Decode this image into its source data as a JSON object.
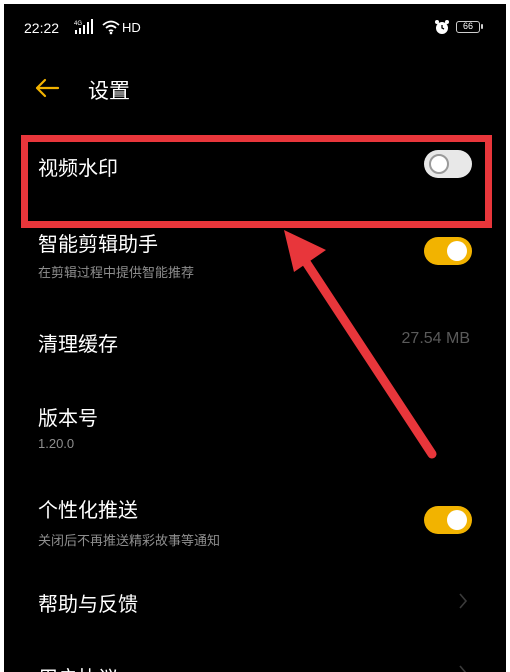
{
  "status_bar": {
    "time": "22:22",
    "network_label": "4G",
    "hd_label": "HD",
    "battery_level": "66"
  },
  "header": {
    "title": "设置"
  },
  "settings": {
    "video_watermark": {
      "title": "视频水印",
      "enabled": false
    },
    "smart_edit": {
      "title": "智能剪辑助手",
      "subtitle": "在剪辑过程中提供智能推荐",
      "enabled": true
    },
    "clear_cache": {
      "title": "清理缓存",
      "value": "27.54 MB"
    },
    "version": {
      "title": "版本号",
      "subtitle": "1.20.0"
    },
    "personalized_push": {
      "title": "个性化推送",
      "subtitle": "关闭后不再推送精彩故事等通知",
      "enabled": true
    },
    "help_feedback": {
      "title": "帮助与反馈"
    },
    "user_agreement": {
      "title": "用户协议"
    }
  },
  "colors": {
    "background": "#000000",
    "accent": "#f2b300",
    "annotation": "#e8363b",
    "secondary_text": "#8e8e8e"
  },
  "icons": {
    "back": "arrow-left-icon",
    "chevron": "chevron-right-icon",
    "alarm": "alarm-clock-icon",
    "wifi": "wifi-icon",
    "signal": "cellular-signal-icon"
  }
}
